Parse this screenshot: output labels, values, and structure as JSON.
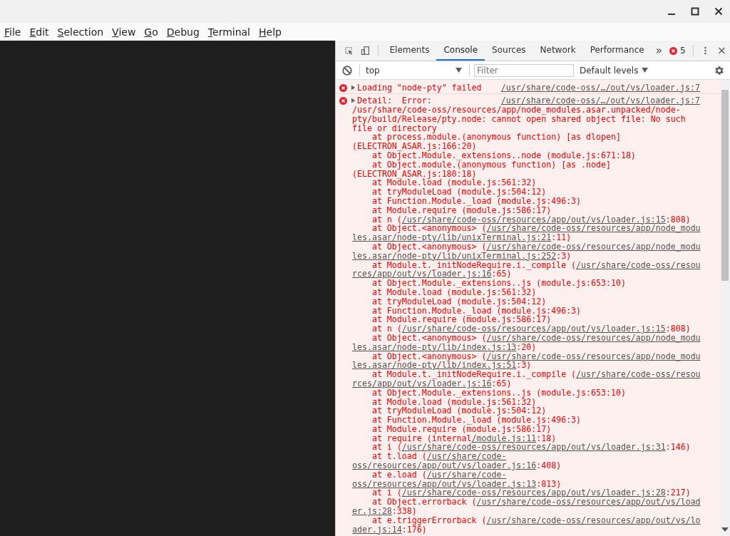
{
  "menu": [
    {
      "label": "File"
    },
    {
      "label": "Edit"
    },
    {
      "label": "Selection"
    },
    {
      "label": "View"
    },
    {
      "label": "Go"
    },
    {
      "label": "Debug"
    },
    {
      "label": "Terminal"
    },
    {
      "label": "Help"
    }
  ],
  "devtools": {
    "tabs": [
      {
        "label": "Elements",
        "selected": false
      },
      {
        "label": "Console",
        "selected": true
      },
      {
        "label": "Sources",
        "selected": false
      },
      {
        "label": "Network",
        "selected": false
      },
      {
        "label": "Performance",
        "selected": false
      }
    ],
    "more_tabs": "»",
    "error_count": "5",
    "console_toolbar": {
      "context": "top",
      "filter": {
        "placeholder": "Filter"
      },
      "levels": "Default levels"
    },
    "messages": [
      {
        "kind": "error",
        "expanded": false,
        "text": "Loading \"node-pty\" failed",
        "source": "/usr/share/code-oss/…/out/vs/loader.js:7"
      },
      {
        "kind": "error",
        "expanded": false,
        "text": "Detail:  Error:",
        "source": "/usr/share/code-oss/…/out/vs/loader.js:7",
        "detail": "/usr/share/code-oss/resources/app/node_modules.asar.unpacked/node-pty/build/Release/pty.node: cannot open shared object file: No such file or directory",
        "frames": [
          {
            "text": "at process.module.(anonymous function) [as dlopen] (ELECTRON_ASAR.js:166:20)"
          },
          {
            "text": "at Object.Module._extensions..node (module.js:671:18)"
          },
          {
            "text": "at Object.module.(anonymous function) [as .node] (ELECTRON_ASAR.js:180:18)"
          },
          {
            "text": "at Module.load (module.js:561:32)"
          },
          {
            "text": "at tryModuleLoad (module.js:504:12)"
          },
          {
            "text": "at Function.Module._load (module.js:496:3)"
          },
          {
            "text": "at Module.require (module.js:586:17)"
          },
          {
            "text": "at n (",
            "link": "/usr/share/code-oss/resources/app/out/vs/loader.js:15",
            "after": ":808)"
          },
          {
            "text": "at Object.<anonymous> (",
            "link": "/usr/share/code-oss/resources/app/node_modu",
            "link_rest": "les.asar/node-pty/lib/unixTerminal.js:21",
            "after": ":11)"
          },
          {
            "text": "at Object.<anonymous> (",
            "link": "/usr/share/code-oss/resources/app/node_modu",
            "link_rest": "les.asar/node-pty/lib/unixTerminal.js:252",
            "after": ":3)"
          },
          {
            "text": "at Module.t._initNodeRequire.i._compile (",
            "link": "/usr/share/code-oss/resou",
            "link_rest": "rces/app/out/vs/loader.js:16",
            "after": ":65)"
          },
          {
            "text": "at Object.Module._extensions..js (module.js:653:10)"
          },
          {
            "text": "at Module.load (module.js:561:32)"
          },
          {
            "text": "at tryModuleLoad (module.js:504:12)"
          },
          {
            "text": "at Function.Module._load (module.js:496:3)"
          },
          {
            "text": "at Module.require (module.js:586:17)"
          },
          {
            "text": "at n (",
            "link": "/usr/share/code-oss/resources/app/out/vs/loader.js:15",
            "after": ":808)"
          },
          {
            "text": "at Object.<anonymous> (",
            "link": "/usr/share/code-oss/resources/app/node_modu",
            "link_rest": "les.asar/node-pty/lib/index.js:13",
            "after": ":20)"
          },
          {
            "text": "at Object.<anonymous> (",
            "link": "/usr/share/code-oss/resources/app/node_modu",
            "link_rest": "les.asar/node-pty/lib/index.js:51",
            "after": ":3)"
          },
          {
            "text": "at Module.t._initNodeRequire.i._compile (",
            "link": "/usr/share/code-oss/resou",
            "link_rest": "rces/app/out/vs/loader.js:16",
            "after": ":65)"
          },
          {
            "text": "at Object.Module._extensions..js (module.js:653:10)"
          },
          {
            "text": "at Module.load (module.js:561:32)"
          },
          {
            "text": "at tryModuleLoad (module.js:504:12)"
          },
          {
            "text": "at Function.Module._load (module.js:496:3)"
          },
          {
            "text": "at Module.require (module.js:586:17)"
          },
          {
            "text": "at require (internal",
            "link": "/module.js:11",
            "after": ":18)"
          },
          {
            "text": "at i (",
            "link": "/usr/share/code-oss/resources/app/out/vs/loader.js:31",
            "after": ":146)"
          },
          {
            "text": "at t.load (",
            "link": "/usr/share/code-",
            "link_rest": "oss/resources/app/out/vs/loader.js:16",
            "after": ":408)"
          },
          {
            "text": "at e.load (",
            "link": "/usr/share/code-",
            "link_rest": "oss/resources/app/out/vs/loader.js:13",
            "after": ":813)"
          },
          {
            "text": "at i (",
            "link": "/usr/share/code-oss/resources/app/out/vs/loader.js:28",
            "after": ":217)"
          },
          {
            "text": "at Object.errorback (",
            "link": "/usr/share/code-oss/resources/app/out/vs/load",
            "link_rest": "er.js:28",
            "after": ":338)"
          },
          {
            "text": "at e.triggerErrorback (",
            "link": "/usr/share/code-oss/resources/app/out/vs/lo",
            "link_rest": "ader.js:14",
            "after": ":176)"
          }
        ]
      }
    ]
  }
}
